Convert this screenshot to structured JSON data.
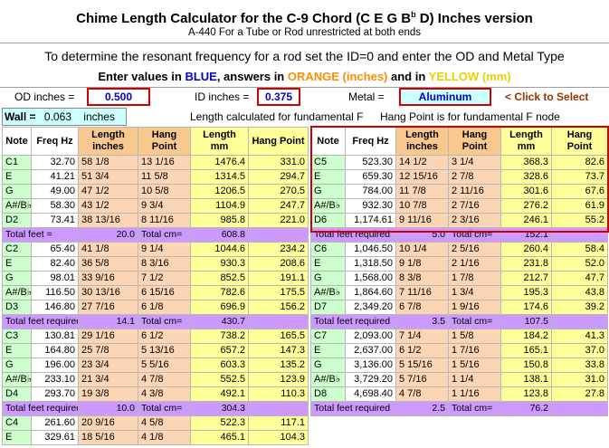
{
  "header": {
    "title": "Chime Length Calculator for the C-9 Chord  (C E G B",
    "title_flat": "b",
    "title_end": " D) Inches version",
    "subtitle": "A-440  For a Tube or Rod unrestricted at both ends",
    "instruction": "To determine the resonant frequency for a rod set the ID=0 and enter the OD and Metal Type",
    "enter_prefix": "Enter values in ",
    "enter_blue": "BLUE",
    "enter_mid": ", answers in ",
    "enter_orange": "ORANGE (inches)",
    "enter_and": " and in ",
    "enter_yellow": "YELLOW (mm)"
  },
  "inputs": {
    "od_label": "OD inches =",
    "od_value": "0.500",
    "id_label": "ID inches =",
    "id_value": "0.375",
    "metal_label": "Metal =",
    "metal_value": "Aluminum",
    "click_hint": "< Click to Select",
    "wall_label": "Wall =",
    "wall_value": "0.063",
    "wall_unit": "inches",
    "length_note": "Length calculated for fundamental F",
    "hang_note": "Hang Point is for fundamental F node"
  },
  "columns": [
    "Note",
    "Freq Hz",
    "Length inches",
    "Hang Point",
    "Length mm",
    "Hang Point"
  ],
  "left": {
    "groups": [
      {
        "rows": [
          [
            "C1",
            "32.70",
            "58  1/8",
            "13  1/16",
            "1476.4",
            "331.0"
          ],
          [
            "E",
            "41.21",
            "51  3/4",
            "11  5/8",
            "1314.5",
            "294.7"
          ],
          [
            "G",
            "49.00",
            "47  1/2",
            "10  5/8",
            "1206.5",
            "270.5"
          ],
          [
            "A#/B♭",
            "58.30",
            "43  1/2",
            "9  3/4",
            "1104.9",
            "247.7"
          ],
          [
            "D2",
            "73.41",
            "38 13/16",
            "8 11/16",
            "985.8",
            "221.0"
          ]
        ],
        "total_label": "Total feet =",
        "total_value": "20.0",
        "cm_label": "Total cm=",
        "cm_value": "608.8"
      },
      {
        "rows": [
          [
            "C2",
            "65.40",
            "41  1/8",
            "9  1/4",
            "1044.6",
            "234.2"
          ],
          [
            "E",
            "82.40",
            "36  5/8",
            "8  3/16",
            "930.3",
            "208.6"
          ],
          [
            "G",
            "98.01",
            "33  9/16",
            "7  1/2",
            "852.5",
            "191.1"
          ],
          [
            "A#/B♭",
            "116.50",
            "30 13/16",
            "6 15/16",
            "782.6",
            "175.5"
          ],
          [
            "D3",
            "146.80",
            "27  7/16",
            "6  1/8",
            "696.9",
            "156.2"
          ]
        ],
        "total_label": "Total feet required",
        "total_value": "14.1",
        "cm_label": "Total cm=",
        "cm_value": "430.7"
      },
      {
        "rows": [
          [
            "C3",
            "130.81",
            "29  1/16",
            "6  1/2",
            "738.2",
            "165.5"
          ],
          [
            "E",
            "164.80",
            "25  7/8",
            "5 13/16",
            "657.2",
            "147.3"
          ],
          [
            "G",
            "196.00",
            "23  3/4",
            "5  5/16",
            "603.3",
            "135.2"
          ],
          [
            "A#/B♭",
            "233.10",
            "21  3/4",
            "4  7/8",
            "552.5",
            "123.9"
          ],
          [
            "D4",
            "293.70",
            "19  3/8",
            "4  3/8",
            "492.1",
            "110.3"
          ]
        ],
        "total_label": "Total feet required",
        "total_value": "10.0",
        "cm_label": "Total cm=",
        "cm_value": "304.3"
      },
      {
        "rows": [
          [
            "C4",
            "261.60",
            "20  9/16",
            "4  5/8",
            "522.3",
            "117.1"
          ],
          [
            "E",
            "329.61",
            "18  5/16",
            "4  1/8",
            "465.1",
            "104.3"
          ]
        ]
      }
    ]
  },
  "right": {
    "groups": [
      {
        "rows": [
          [
            "C5",
            "523.30",
            "14  1/2",
            "3  1/4",
            "368.3",
            "82.6"
          ],
          [
            "E",
            "659.30",
            "12 15/16",
            "2  7/8",
            "328.6",
            "73.7"
          ],
          [
            "G",
            "784.00",
            "11  7/8",
            "2 11/16",
            "301.6",
            "67.6"
          ],
          [
            "A#/B♭",
            "932.30",
            "10  7/8",
            "2  7/16",
            "276.2",
            "61.9"
          ],
          [
            "D6",
            "1,174.61",
            "9 11/16",
            "2  3/16",
            "246.1",
            "55.2"
          ]
        ],
        "total_label": "Total feet required",
        "total_value": "5.0",
        "cm_label": "Total cm=",
        "cm_value": "152.1"
      },
      {
        "rows": [
          [
            "C6",
            "1,046.50",
            "10  1/4",
            "2  5/16",
            "260.4",
            "58.4"
          ],
          [
            "E",
            "1,318.50",
            "9  1/8",
            "2  1/16",
            "231.8",
            "52.0"
          ],
          [
            "G",
            "1,568.00",
            "8  3/8",
            "1  7/8",
            "212.7",
            "47.7"
          ],
          [
            "A#/B♭",
            "1,864.60",
            "7 11/16",
            "1  3/4",
            "195.3",
            "43.8"
          ],
          [
            "D7",
            "2,349.20",
            "6  7/8",
            "1  9/16",
            "174.6",
            "39.2"
          ]
        ],
        "total_label": "Total feet required",
        "total_value": "3.5",
        "cm_label": "Total cm=",
        "cm_value": "107.5"
      },
      {
        "rows": [
          [
            "C7",
            "2,093.00",
            "7  1/4",
            "1  5/8",
            "184.2",
            "41.3"
          ],
          [
            "E",
            "2,637.00",
            "6  1/2",
            "1  7/16",
            "165.1",
            "37.0"
          ],
          [
            "G",
            "3,136.00",
            "5 15/16",
            "1  5/16",
            "150.8",
            "33.8"
          ],
          [
            "A#/B♭",
            "3,729.20",
            "5  7/16",
            "1  1/4",
            "138.1",
            "31.0"
          ],
          [
            "D8",
            "4,698.40",
            "4  7/8",
            "1  1/16",
            "123.8",
            "27.8"
          ]
        ],
        "total_label": "Total feet required",
        "total_value": "2.5",
        "cm_label": "Total cm=",
        "cm_value": "76.2"
      }
    ]
  }
}
